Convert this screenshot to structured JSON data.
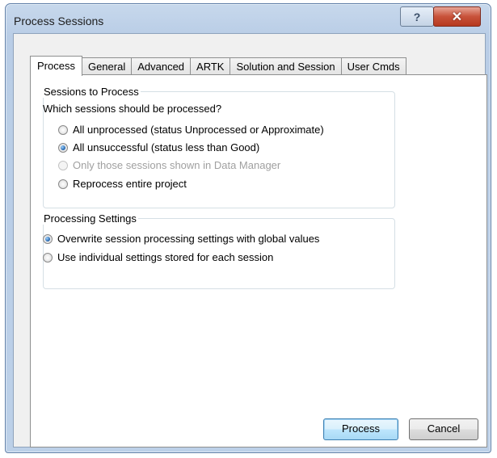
{
  "window": {
    "title": "Process Sessions",
    "help_label": "?",
    "close_label": "✕"
  },
  "tabs": [
    {
      "label": "Process",
      "active": true
    },
    {
      "label": "General"
    },
    {
      "label": "Advanced"
    },
    {
      "label": "ARTK"
    },
    {
      "label": "Solution and Session"
    },
    {
      "label": "User Cmds"
    }
  ],
  "sessions_group": {
    "label": "Sessions to Process",
    "question": "Which sessions should be processed?",
    "options": [
      {
        "label": "All unprocessed (status Unprocessed or Approximate)",
        "checked": false,
        "enabled": true
      },
      {
        "label": "All unsuccessful (status less than Good)",
        "checked": true,
        "enabled": true
      },
      {
        "label": "Only those sessions shown in Data Manager",
        "checked": false,
        "enabled": false
      },
      {
        "label": "Reprocess entire project",
        "checked": false,
        "enabled": true
      }
    ]
  },
  "settings_group": {
    "label": "Processing Settings",
    "options": [
      {
        "label": "Overwrite session processing settings with global values",
        "checked": true
      },
      {
        "label": "Use individual settings stored for each session",
        "checked": false
      }
    ]
  },
  "buttons": {
    "process": "Process",
    "cancel": "Cancel"
  },
  "icons": {
    "help": "help-icon",
    "close": "close-icon",
    "radio_checked": "radio-checked-icon",
    "radio_unchecked": "radio-unchecked-icon"
  }
}
